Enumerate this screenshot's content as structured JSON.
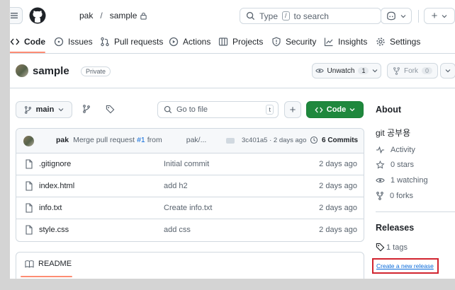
{
  "header": {
    "owner": "pak",
    "separator": "/",
    "repo": "sample",
    "search_placeholder": "Type",
    "search_hint": "/",
    "search_suffix": "to search",
    "plus_label": "+"
  },
  "tabs": [
    {
      "label": "Code"
    },
    {
      "label": "Issues"
    },
    {
      "label": "Pull requests"
    },
    {
      "label": "Actions"
    },
    {
      "label": "Projects"
    },
    {
      "label": "Security"
    },
    {
      "label": "Insights"
    },
    {
      "label": "Settings"
    }
  ],
  "repo": {
    "name": "sample",
    "visibility": "Private",
    "unwatch_label": "Unwatch",
    "watch_count": "1",
    "fork_label": "Fork",
    "fork_count": "0"
  },
  "toolbar": {
    "branch": "main",
    "goto_placeholder": "Go to file",
    "goto_key": "t",
    "plus": "+",
    "code_label": "Code"
  },
  "commit": {
    "author": "pak",
    "message_prefix": "Merge pull request",
    "pr_link": "#1",
    "message_suffix": "from",
    "branch_ref": "pak/...",
    "hash_info": "3c401a5 · 2 days ago",
    "commits_label": "6 Commits"
  },
  "files": [
    {
      "name": ".gitignore",
      "message": "Initial commit",
      "date": "2 days ago"
    },
    {
      "name": "index.html",
      "message": "add h2",
      "date": "2 days ago"
    },
    {
      "name": "info.txt",
      "message": "Create info.txt",
      "date": "2 days ago"
    },
    {
      "name": "style.css",
      "message": "add css",
      "date": "2 days ago"
    }
  ],
  "readme": {
    "label": "README"
  },
  "about": {
    "title": "About",
    "description": "git 공부용",
    "activity": "Activity",
    "stars": "0 stars",
    "watching": "1 watching",
    "forks": "0 forks"
  },
  "releases": {
    "title": "Releases",
    "tags": "1 tags",
    "create_link": "Create a new release",
    "highlight_color": "#d1242f"
  },
  "colors": {
    "accent": "#fd8c73",
    "code_button": "#1f883d",
    "link": "#0969da"
  }
}
